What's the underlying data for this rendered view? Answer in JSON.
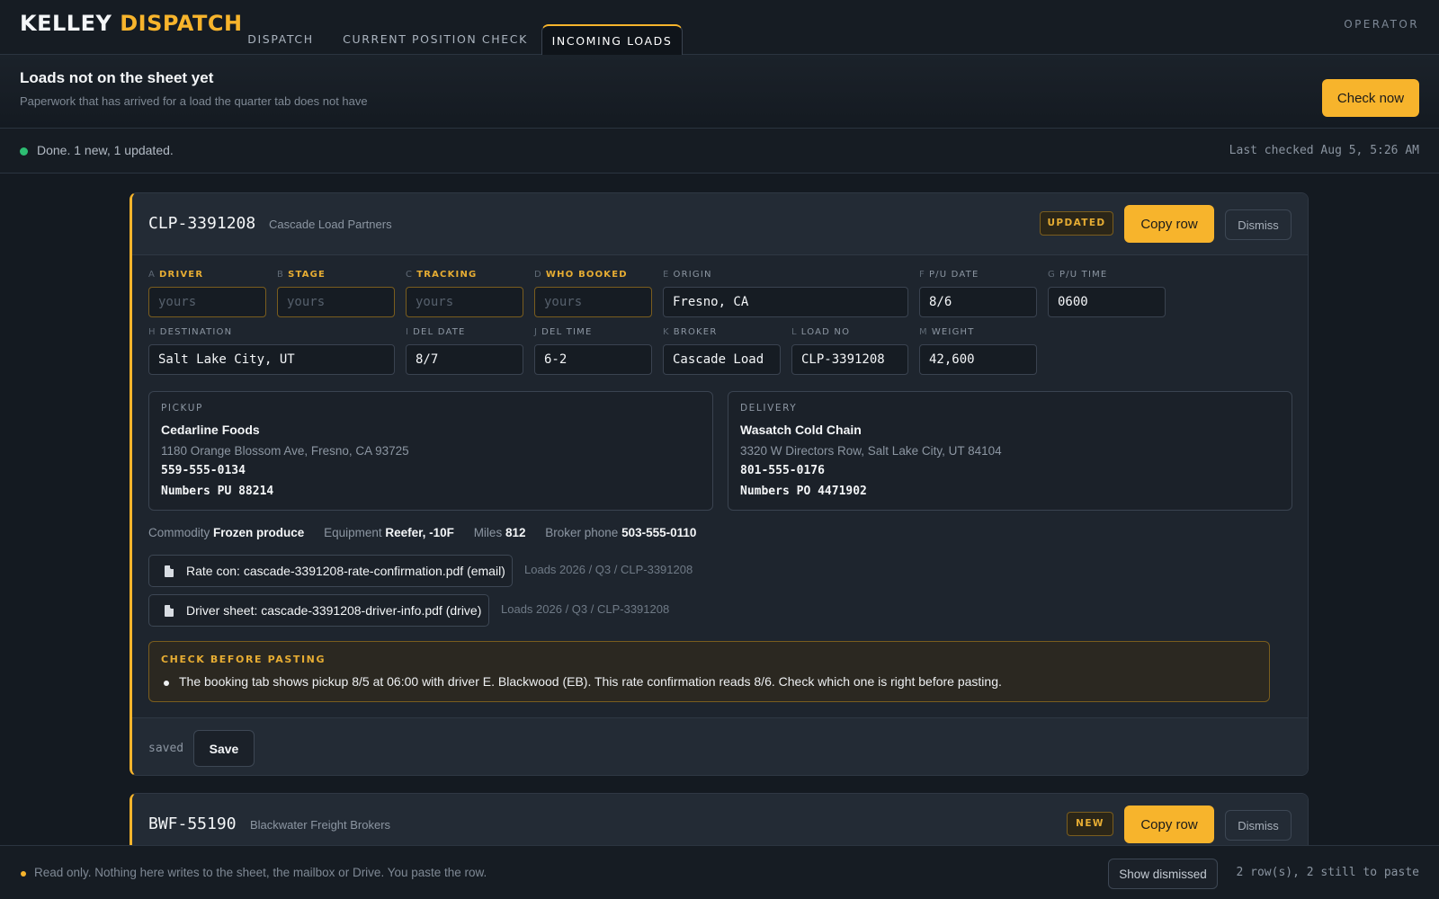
{
  "brand": {
    "part1": "KELLEY",
    "part2": "DISPATCH"
  },
  "nav": {
    "tabs": [
      {
        "label": "DISPATCH"
      },
      {
        "label": "CURRENT POSITION CHECK"
      },
      {
        "label": "INCOMING LOADS",
        "active": true
      }
    ],
    "operator": "OPERATOR"
  },
  "header": {
    "title": "Loads not on the sheet yet",
    "subtitle": "Paperwork that has arrived for a load the quarter tab does not have",
    "check_now": "Check now"
  },
  "status": {
    "text": "Done. 1 new, 1 updated.",
    "last_checked": "Last checked Aug 5, 5:26 AM",
    "color": "#2dbd72"
  },
  "loads": [
    {
      "id": "CLP-3391208",
      "company": "Cascade Load Partners",
      "badge": "UPDATED",
      "copy_label": "Copy row",
      "dismiss_label": "Dismiss",
      "fields": {
        "A": {
          "col": "A",
          "label": "DRIVER",
          "value": "",
          "placeholder": "yours"
        },
        "B": {
          "col": "B",
          "label": "STAGE",
          "value": "",
          "placeholder": "yours"
        },
        "C": {
          "col": "C",
          "label": "TRACKING",
          "value": "",
          "placeholder": "yours"
        },
        "D": {
          "col": "D",
          "label": "WHO BOOKED",
          "value": "",
          "placeholder": "yours"
        },
        "E": {
          "col": "E",
          "label": "ORIGIN",
          "value": "Fresno, CA"
        },
        "F": {
          "col": "F",
          "label": "P/U DATE",
          "value": "8/6"
        },
        "G": {
          "col": "G",
          "label": "P/U TIME",
          "value": "0600"
        },
        "H": {
          "col": "H",
          "label": "DESTINATION",
          "value": "Salt Lake City, UT"
        },
        "I": {
          "col": "I",
          "label": "DEL DATE",
          "value": "8/7"
        },
        "J": {
          "col": "J",
          "label": "DEL TIME",
          "value": "6-2"
        },
        "K": {
          "col": "K",
          "label": "BROKER",
          "value": "Cascade Load"
        },
        "L": {
          "col": "L",
          "label": "LOAD NO",
          "value": "CLP-3391208"
        },
        "M": {
          "col": "M",
          "label": "WEIGHT",
          "value": "42,600"
        }
      },
      "pickup": {
        "label": "PICKUP",
        "name": "Cedarline Foods",
        "address": "1180 Orange Blossom Ave, Fresno, CA 93725",
        "phone": "559-555-0134",
        "ref": "Numbers PU 88214"
      },
      "delivery": {
        "label": "DELIVERY",
        "name": "Wasatch Cold Chain",
        "address": "3320 W Directors Row, Salt Lake City, UT 84104",
        "phone": "801-555-0176",
        "ref": "Numbers PO 4471902"
      },
      "meta": {
        "commodity_label": "Commodity",
        "commodity": "Frozen produce",
        "equipment_label": "Equipment",
        "equipment": "Reefer, -10F",
        "miles_label": "Miles",
        "miles": "812",
        "broker_phone_label": "Broker phone",
        "broker_phone": "503-555-0110"
      },
      "docs": [
        {
          "label": "Rate con: cascade-3391208-rate-confirmation.pdf (email)",
          "path": "Loads 2026 / Q3 / CLP-3391208",
          "icon": "document-icon"
        },
        {
          "label": "Driver sheet: cascade-3391208-driver-info.pdf (drive)",
          "path": "Loads 2026 / Q3 / CLP-3391208",
          "icon": "document-icon"
        }
      ],
      "warning": {
        "title": "CHECK BEFORE PASTING",
        "items": [
          "The booking tab shows pickup 8/5 at 06:00 with driver E. Blackwood (EB). This rate confirmation reads 8/6. Check which one is right before pasting."
        ]
      },
      "saved_text": "saved",
      "save_label": "Save"
    },
    {
      "id": "BWF-55190",
      "company": "Blackwater Freight Brokers",
      "badge": "NEW",
      "copy_label": "Copy row",
      "dismiss_label": "Dismiss"
    }
  ],
  "footer": {
    "text": "Read only. Nothing here writes to the sheet, the mailbox or Drive. You paste the row.",
    "show_dismissed": "Show dismissed",
    "row_count": "2 row(s), 2 still to paste"
  },
  "colors": {
    "accent": "#f7b42c",
    "background": "#141a21",
    "ok": "#2dbd72"
  }
}
